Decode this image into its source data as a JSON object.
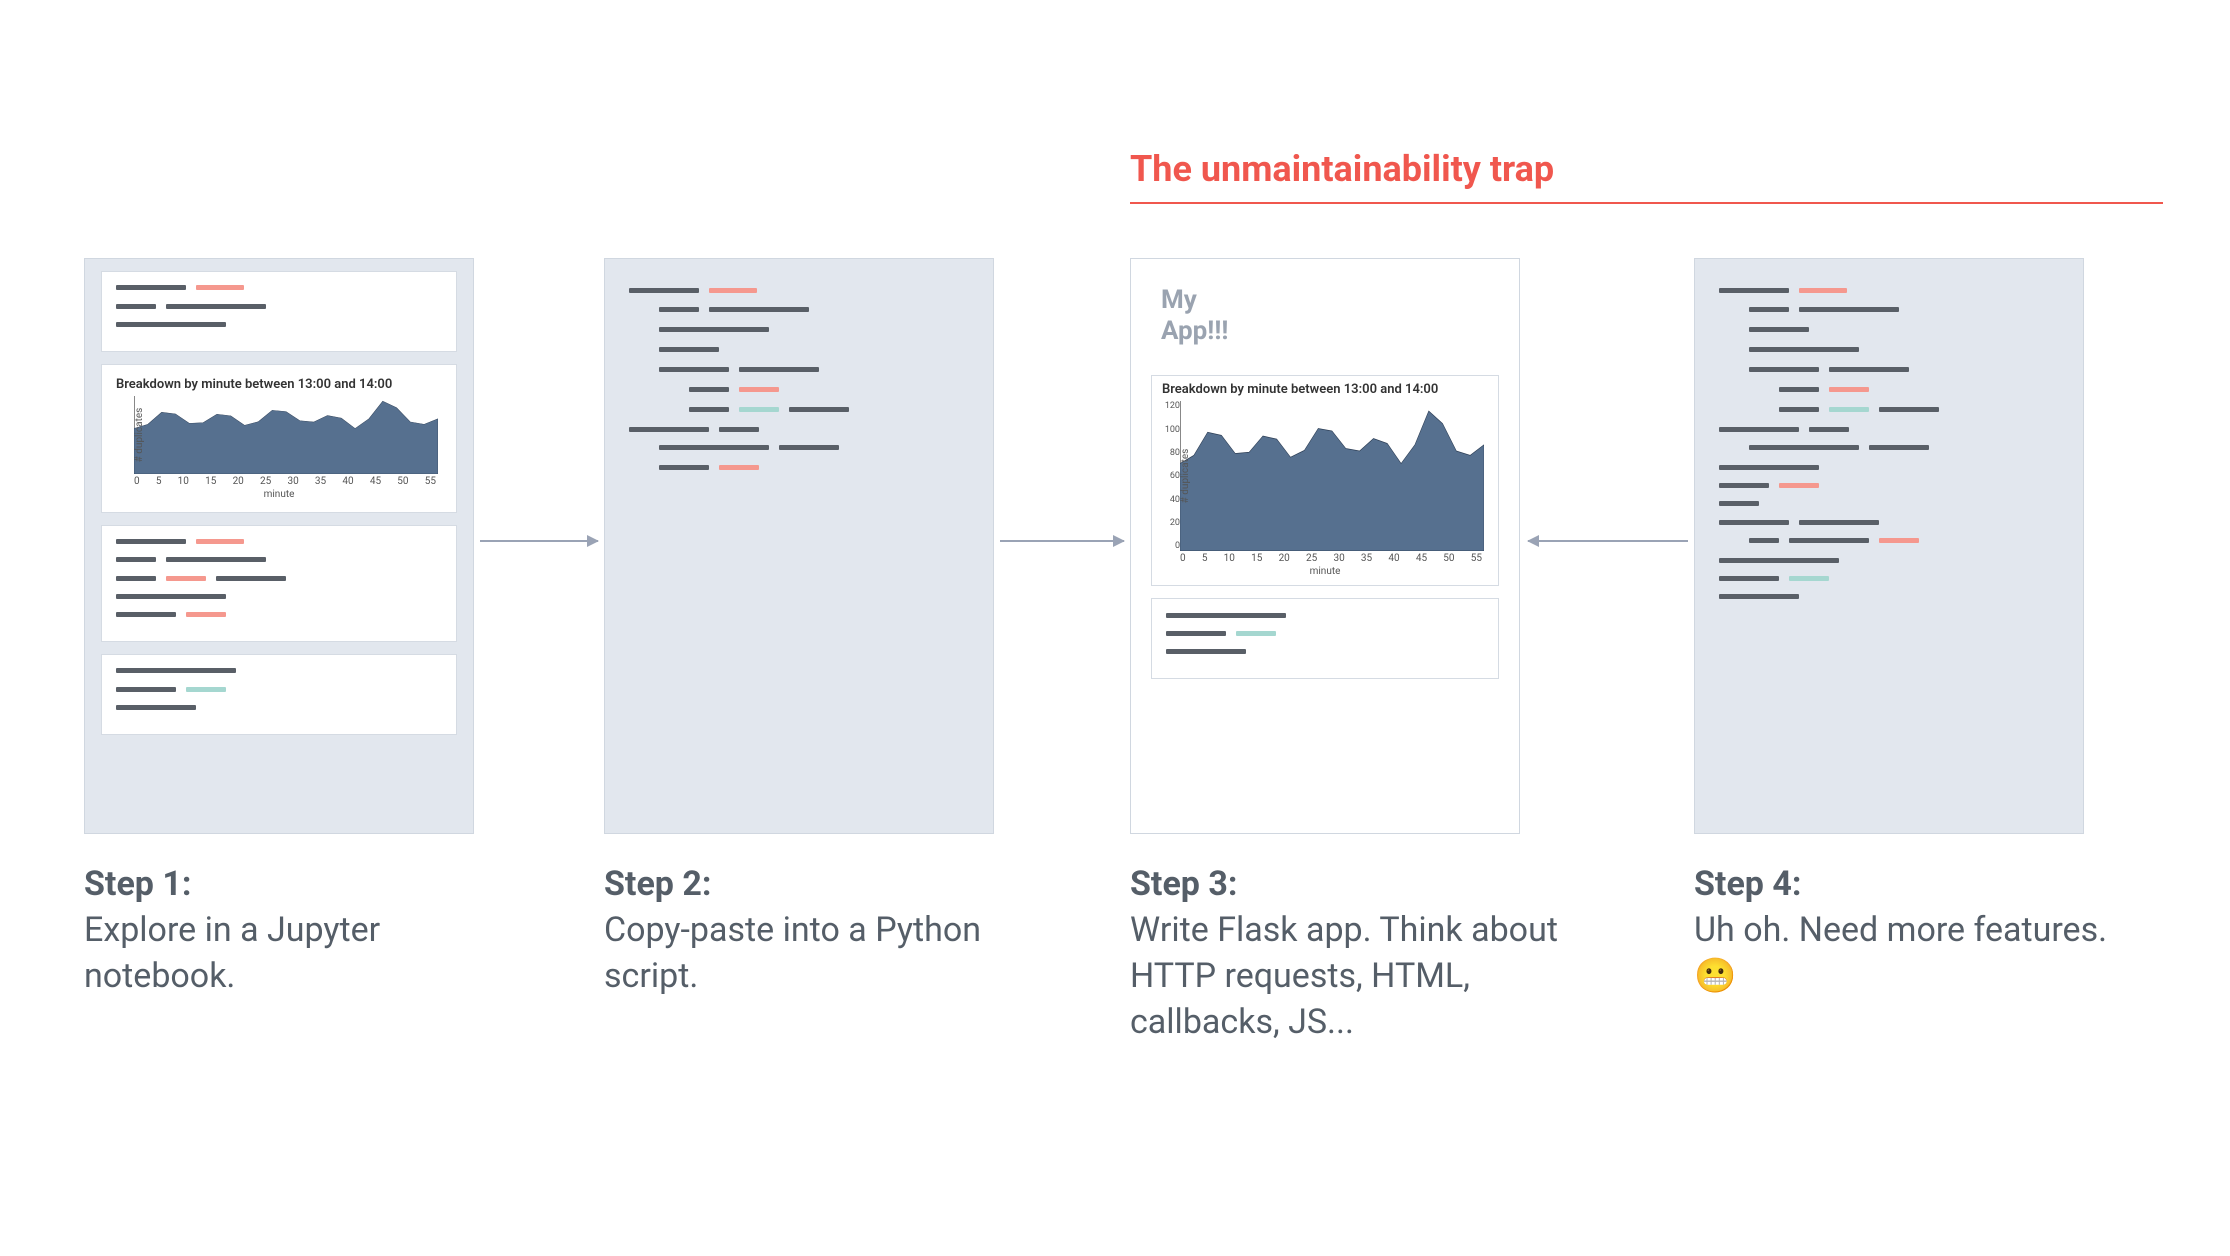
{
  "trap_title": "The unmaintainability trap",
  "steps": [
    {
      "label": "Step 1:",
      "text": "Explore in a Jupyter notebook."
    },
    {
      "label": "Step 2:",
      "text": "Copy-paste into a Python script."
    },
    {
      "label": "Step 3:",
      "text": "Write Flask app. Think about HTTP requests, HTML, callbacks, JS..."
    },
    {
      "label": "Step 4:",
      "text": "Uh oh. Need more features.😬"
    }
  ],
  "app": {
    "title_line1": "My",
    "title_line2": "App!!!"
  },
  "chart_data": {
    "type": "area",
    "title": "Breakdown by minute between 13:00 and 14:00",
    "xlabel": "minute",
    "ylabel": "# duplicates",
    "x": [
      0,
      5,
      10,
      15,
      20,
      25,
      30,
      35,
      40,
      45,
      50,
      55
    ],
    "values": [
      70,
      95,
      78,
      92,
      75,
      98,
      82,
      90,
      70,
      112,
      80,
      85
    ],
    "ylim": [
      0,
      120
    ],
    "xlim": [
      0,
      55
    ],
    "yticks": [
      0,
      20,
      40,
      60,
      80,
      100,
      120
    ],
    "xticks": [
      0,
      5,
      10,
      15,
      20,
      25,
      30,
      35,
      40,
      45,
      50,
      55
    ]
  },
  "colors": {
    "grey": "#595f67",
    "salmon": "#f5988e",
    "teal": "#a5d7d0",
    "panel": "#e2e7ee",
    "arrow": "#9aa3b5",
    "trap": "#f0574e",
    "chart_fill": "#56708f"
  },
  "code_panels": {
    "panel1": {
      "cells": [
        {
          "rows": [
            [
              [
                "g",
                70
              ],
              [
                "r",
                48
              ]
            ],
            [
              [
                "g",
                40
              ],
              [
                "g",
                100
              ]
            ],
            [
              [
                "g",
                110
              ]
            ]
          ]
        },
        {
          "chart": true
        },
        {
          "rows": [
            [
              [
                "g",
                70
              ],
              [
                "r",
                48
              ]
            ],
            [
              [
                "g",
                40
              ],
              [
                "g",
                100
              ]
            ],
            [
              [
                "g",
                40
              ],
              [
                "r",
                40
              ],
              [
                "g",
                70
              ]
            ],
            [
              [
                "g",
                110
              ]
            ],
            [
              [
                "g",
                60
              ],
              [
                "r",
                40
              ]
            ]
          ]
        },
        {
          "rows": [
            [
              [
                "g",
                120
              ]
            ],
            [
              [
                "g",
                60
              ],
              [
                "cy",
                40
              ]
            ],
            [
              [
                "g",
                80
              ]
            ]
          ]
        }
      ]
    },
    "panel2": {
      "rows": [
        [
          [
            "g",
            70
          ],
          [
            "r",
            48
          ]
        ],
        [
          [
            "i",
            30
          ],
          [
            "g",
            40
          ],
          [
            "g",
            100
          ]
        ],
        [
          [
            "i",
            30
          ],
          [
            "g",
            110
          ]
        ],
        [
          [
            "i",
            30
          ],
          [
            "g",
            60
          ]
        ],
        [
          [
            "i",
            30
          ],
          [
            "g",
            70
          ],
          [
            "g",
            80
          ]
        ],
        [
          [
            "i",
            60
          ],
          [
            "g",
            40
          ],
          [
            "r",
            40
          ]
        ],
        [
          [
            "i",
            60
          ],
          [
            "g",
            40
          ],
          [
            "cy",
            40
          ],
          [
            "g",
            60
          ]
        ],
        [],
        [
          [
            "g",
            80
          ],
          [
            "g",
            40
          ]
        ],
        [
          [
            "i",
            30
          ],
          [
            "g",
            110
          ],
          [
            "g",
            60
          ]
        ],
        [
          [
            "i",
            30
          ],
          [
            "g",
            50
          ],
          [
            "r",
            40
          ]
        ]
      ]
    },
    "panel3_small_cell": {
      "rows": [
        [
          [
            "g",
            120
          ]
        ],
        [
          [
            "g",
            60
          ],
          [
            "cy",
            40
          ]
        ],
        [
          [
            "g",
            80
          ]
        ]
      ]
    },
    "panel4": {
      "rows": [
        [
          [
            "g",
            70
          ],
          [
            "r",
            48
          ]
        ],
        [
          [
            "i",
            30
          ],
          [
            "g",
            40
          ],
          [
            "g",
            100
          ]
        ],
        [
          [
            "i",
            30
          ],
          [
            "g",
            60
          ]
        ],
        [
          [
            "i",
            30
          ],
          [
            "g",
            110
          ]
        ],
        [
          [
            "i",
            30
          ],
          [
            "g",
            70
          ],
          [
            "g",
            80
          ]
        ],
        [
          [
            "i",
            60
          ],
          [
            "g",
            40
          ],
          [
            "r",
            40
          ]
        ],
        [
          [
            "i",
            60
          ],
          [
            "g",
            40
          ],
          [
            "cy",
            40
          ],
          [
            "g",
            60
          ]
        ],
        [],
        [
          [
            "g",
            80
          ],
          [
            "g",
            40
          ]
        ],
        [
          [
            "i",
            30
          ],
          [
            "g",
            110
          ],
          [
            "g",
            60
          ]
        ],
        [
          [
            "g",
            100
          ]
        ],
        [
          [
            "g",
            50
          ],
          [
            "r",
            40
          ]
        ],
        [
          [
            "g",
            40
          ]
        ],
        [
          [
            "g",
            70
          ],
          [
            "g",
            80
          ]
        ],
        [
          [
            "i",
            30
          ],
          [
            "g",
            30
          ],
          [
            "g",
            80
          ],
          [
            "r",
            40
          ]
        ],
        [],
        [
          [
            "g",
            120
          ]
        ],
        [
          [
            "g",
            60
          ],
          [
            "cy",
            40
          ]
        ],
        [
          [
            "g",
            80
          ]
        ]
      ]
    }
  }
}
